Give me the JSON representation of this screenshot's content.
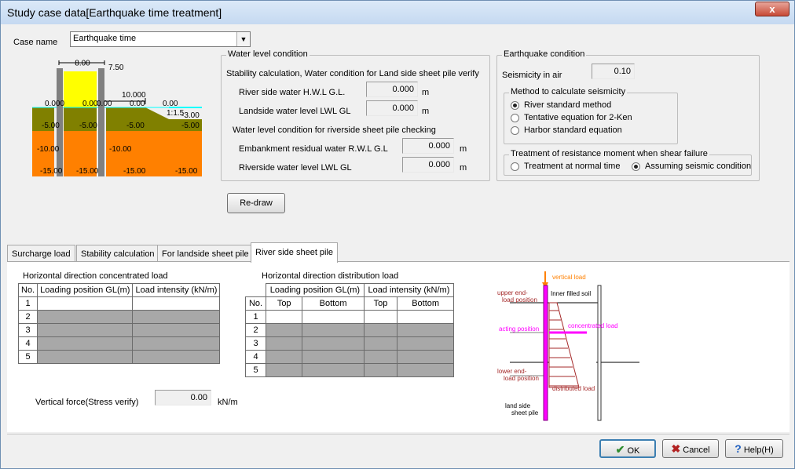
{
  "window": {
    "title": "Study case data[Earthquake time treatment]",
    "close_glyph": "x"
  },
  "case": {
    "label": "Case name",
    "value": "Earthquake time"
  },
  "section_diagram": {
    "top_width": "8.00",
    "top_right": "7.50",
    "berm_width": "10.000",
    "slope": "1:1.5",
    "wl": [
      "0.000",
      "0.00",
      "0.00",
      "0.00",
      "0.00"
    ],
    "toe": "-3.00",
    "levels_mid": [
      "-5.00",
      "-5.00",
      "-5.00",
      "-5.00"
    ],
    "levels_deep": [
      "-10.00",
      "-10.00"
    ],
    "levels_bottom": [
      "-15.00",
      "-15.00",
      "-15.00",
      "-15.00"
    ],
    "colors": {
      "embankment": "#ffff00",
      "upper_soil": "#808000",
      "lower_soil": "#ff8000",
      "pile": "#808080",
      "water": "#00ffff"
    }
  },
  "water_level": {
    "title": "Water level condition",
    "subtitle1": "Stability calculation, Water condition for Land side sheet pile verify",
    "river_hwl_label": "River side water H.W.L  G.L.",
    "river_hwl_value": "0.000",
    "land_lwl_label": "Landside water level LWL GL",
    "land_lwl_value": "0.000",
    "subtitle2": "Water level condition for riverside sheet pile checking",
    "embank_rwl_label": "Embankment residual water R.W.L  G.L",
    "embank_rwl_value": "0.000",
    "river_lwl_label": "Riverside water level LWL GL",
    "river_lwl_value": "0.000",
    "unit": "m"
  },
  "earthquake": {
    "title": "Earthquake condition",
    "seismicity_label": "Seismicity in air",
    "seismicity_value": "0.10",
    "method_title": "Method to calculate seismicity",
    "methods": [
      "River standard method",
      "Tentative equation for 2-Ken",
      "Harbor standard equation"
    ],
    "method_selected": "River standard method",
    "resist_title": "Treatment of resistance moment when shear failure",
    "resist_options": [
      "Treatment at normal time",
      "Assuming seismic condition"
    ],
    "resist_selected": "Assuming seismic condition"
  },
  "redraw_label": "Re-draw",
  "tabs": [
    "Surcharge load",
    "Stability calculation",
    "For landside sheet pile",
    "River side sheet pile"
  ],
  "active_tab": "River side sheet pile",
  "conc_load": {
    "title": "Horizontal direction concentrated load",
    "headers": [
      "No.",
      "Loading position GL(m)",
      "Load intensity (kN/m)"
    ],
    "rows": [
      "1",
      "2",
      "3",
      "4",
      "5"
    ]
  },
  "dist_load": {
    "title": "Horizontal direction distribution load",
    "group_headers": [
      "Loading position GL(m)",
      "Load intensity (kN/m)"
    ],
    "headers": [
      "No.",
      "Top",
      "Bottom",
      "Top",
      "Bottom"
    ],
    "rows": [
      "1",
      "2",
      "3",
      "4",
      "5"
    ]
  },
  "vertical_force": {
    "label": "Vertical force(Stress verify)",
    "value": "0.00",
    "unit": "kN/m"
  },
  "load_diagram": {
    "vertical_load": "vertical load",
    "upper_end1": "upper end-",
    "upper_end2": "load position",
    "inner_soil": "Inner filled soil",
    "conc_load": "concentrated load",
    "acting_pos": "acting position",
    "lower_end1": "lower end-",
    "lower_end2": "load position",
    "dist_load": "distributed load",
    "pile1": "land side",
    "pile2": "sheet pile"
  },
  "buttons": {
    "ok": "OK",
    "cancel": "Cancel",
    "help": "Help(H)"
  }
}
